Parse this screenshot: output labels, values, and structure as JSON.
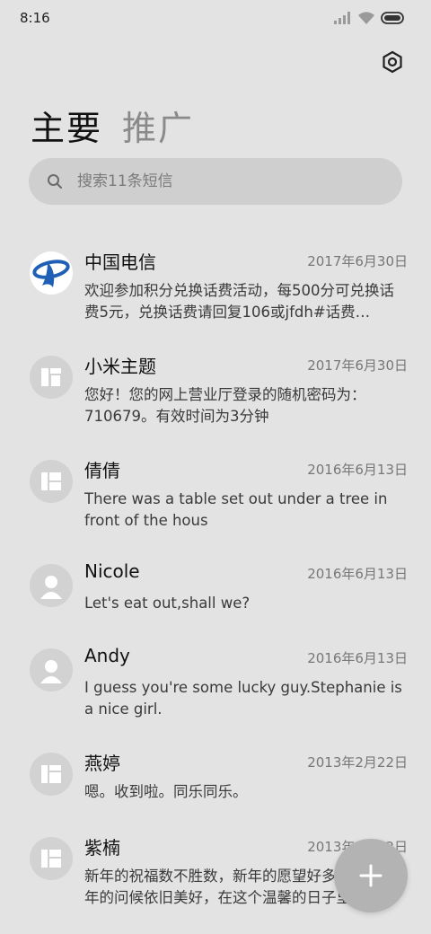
{
  "status_bar": {
    "time": "8:16"
  },
  "tabs": [
    {
      "label": "主要",
      "active": true
    },
    {
      "label": "推广",
      "active": false
    }
  ],
  "search": {
    "placeholder": "搜索11条短信"
  },
  "conversations": [
    {
      "name": "中国电信",
      "date": "2017年6月30日",
      "preview": "欢迎参加积分兑换话费活动，每500分可兑换话费5元，兑换话费请回复106或jfdh#话费…",
      "avatar": "china-telecom-logo"
    },
    {
      "name": "小米主题",
      "date": "2017年6月30日",
      "preview": "您好！您的网上营业厅登录的随机密码为：710679。有效时间为3分钟",
      "avatar": "contact-icon"
    },
    {
      "name": "倩倩",
      "date": "2016年6月13日",
      "preview": "There was a table set out under a tree in front of the hous",
      "avatar": "contact-icon"
    },
    {
      "name": "Nicole",
      "date": "2016年6月13日",
      "preview": "Let's eat out,shall we?",
      "avatar": "person-icon"
    },
    {
      "name": "Andy",
      "date": "2016年6月13日",
      "preview": "I guess you're some lucky guy.Stephanie is a nice girl.",
      "avatar": "person-icon"
    },
    {
      "name": "燕婷",
      "date": "2013年2月22日",
      "preview": "嗯。收到啦。同乐同乐。",
      "avatar": "contact-icon"
    },
    {
      "name": "紫楠",
      "date": "2013年2月22日",
      "preview": "新年的祝福数不胜数，新年的愿望好多好多，新年的问候依旧美好，在这个温馨的日子里",
      "avatar": "contact-icon"
    }
  ],
  "fab": {
    "icon": "plus-icon"
  },
  "colors": {
    "background": "#e3e3e3",
    "search_bg": "#cfcfcf",
    "fab_bg": "#b3b3b3",
    "telecom_blue": "#1f5fb5"
  }
}
